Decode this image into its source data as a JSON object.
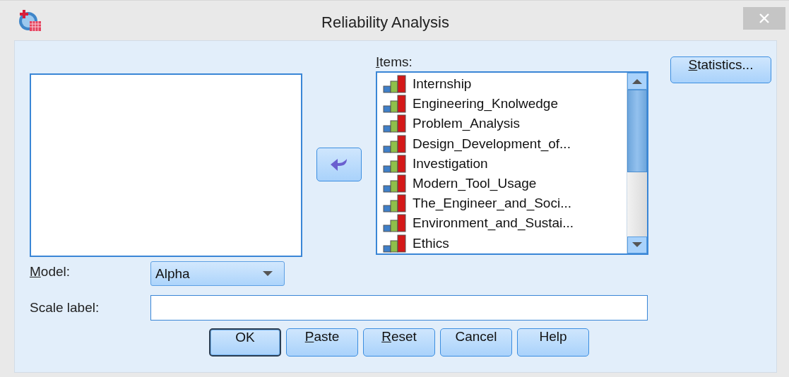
{
  "window": {
    "title": "Reliability Analysis"
  },
  "items_list": {
    "label": "Items:",
    "mnemonic": true,
    "items": [
      {
        "name": "Internship"
      },
      {
        "name": "Engineering_Knolwedge"
      },
      {
        "name": "Problem_Analysis"
      },
      {
        "name": "Design_Development_of..."
      },
      {
        "name": "Investigation"
      },
      {
        "name": "Modern_Tool_Usage"
      },
      {
        "name": "The_Engineer_and_Soci..."
      },
      {
        "name": "Environment_and_Sustai..."
      },
      {
        "name": "Ethics"
      }
    ]
  },
  "statistics_button": {
    "label": "Statistics...",
    "mnemonic": true
  },
  "model": {
    "label": "Model:",
    "mnemonic": true,
    "value": "Alpha"
  },
  "scale_label": {
    "label": "Scale label:",
    "mnemonic": false
  },
  "buttons": [
    {
      "label": "OK",
      "mnemonic": false,
      "default": true
    },
    {
      "label": "Paste",
      "mnemonic": true,
      "default": false
    },
    {
      "label": "Reset",
      "mnemonic": true,
      "default": false
    },
    {
      "label": "Cancel",
      "mnemonic": false,
      "default": false
    },
    {
      "label": "Help",
      "mnemonic": false,
      "default": false
    }
  ]
}
